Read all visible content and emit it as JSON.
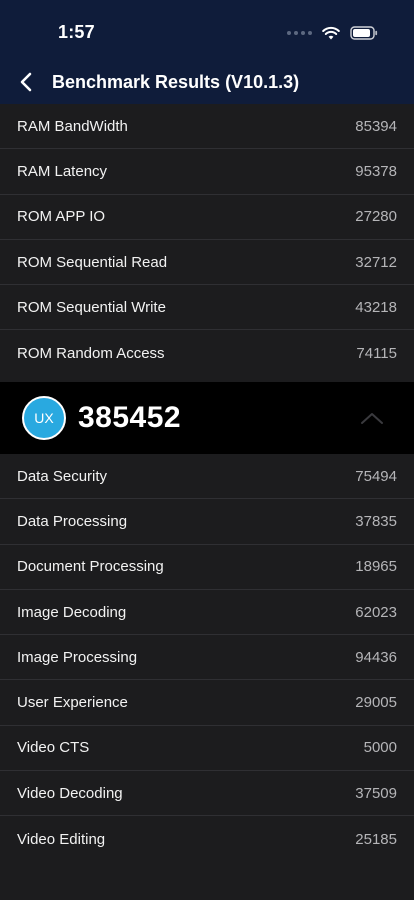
{
  "status_bar": {
    "time": "1:57",
    "icons": [
      "cellular-dots-icon",
      "wifi-icon",
      "battery-icon"
    ]
  },
  "nav": {
    "title": "Benchmark Results (V10.1.3)",
    "back_icon": "chevron-left-icon"
  },
  "mem_rows": [
    {
      "label": "RAM BandWidth",
      "value": "85394"
    },
    {
      "label": "RAM Latency",
      "value": "95378"
    },
    {
      "label": "ROM APP IO",
      "value": "27280"
    },
    {
      "label": "ROM Sequential Read",
      "value": "32712"
    },
    {
      "label": "ROM Sequential Write",
      "value": "43218"
    },
    {
      "label": "ROM Random Access",
      "value": "74115"
    }
  ],
  "ux_section": {
    "badge": "UX",
    "score": "385452",
    "toggle_icon": "chevron-up-icon"
  },
  "ux_rows": [
    {
      "label": "Data Security",
      "value": "75494"
    },
    {
      "label": "Data Processing",
      "value": "37835"
    },
    {
      "label": "Document Processing",
      "value": "18965"
    },
    {
      "label": "Image Decoding",
      "value": "62023"
    },
    {
      "label": "Image Processing",
      "value": "94436"
    },
    {
      "label": "User Experience",
      "value": "29005"
    },
    {
      "label": "Video CTS",
      "value": "5000"
    },
    {
      "label": "Video Decoding",
      "value": "37509"
    },
    {
      "label": "Video Editing",
      "value": "25185"
    }
  ],
  "colors": {
    "header_bg": "#0f1c3a",
    "list_bg": "#1c1c1e",
    "badge": "#29a9e0"
  }
}
